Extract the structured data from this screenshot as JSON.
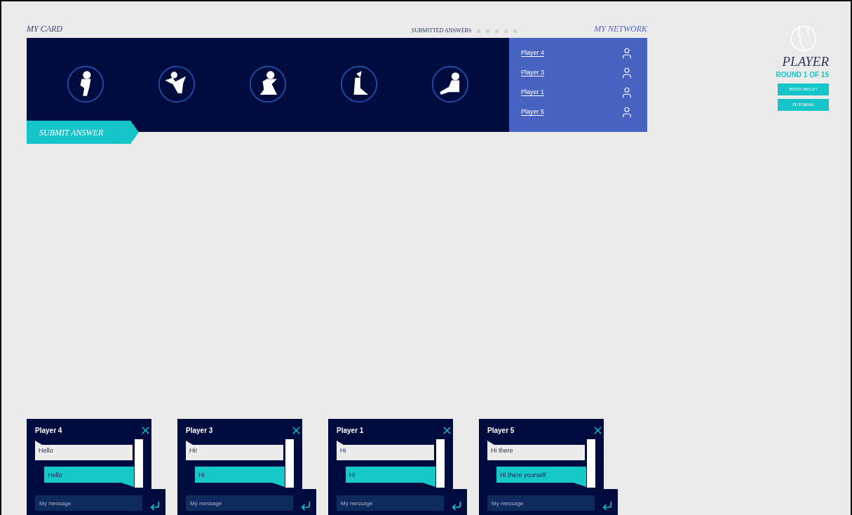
{
  "card": {
    "title": "MY CARD",
    "figures": [
      {
        "kind": "leaping"
      },
      {
        "kind": "flying"
      },
      {
        "kind": "kneeling"
      },
      {
        "kind": "seated"
      },
      {
        "kind": "reclining"
      }
    ],
    "submit_button": "SUBMIT ANSWER"
  },
  "submitted_answers": {
    "label": "SUBMITTED ANSWERS",
    "dots": [
      {
        "filled": false
      },
      {
        "filled": false
      },
      {
        "filled": false
      },
      {
        "filled": false
      },
      {
        "filled": false
      }
    ]
  },
  "network": {
    "title": "MY NETWORK",
    "players": [
      "Player 4",
      "Player 3",
      "Player 1",
      "Player 5"
    ]
  },
  "player": {
    "name": "PLAYER",
    "round": "ROUND 1 OF 15",
    "buttons": [
      "NEED HELP?",
      "TUTORIAL"
    ]
  },
  "chats": [
    {
      "title": "Player 4",
      "messages": [
        {
          "kind": "incoming",
          "text": "Hello"
        },
        {
          "kind": "outgoing",
          "text": "Hello"
        }
      ],
      "placeholder": "My message"
    },
    {
      "title": "Player 3",
      "messages": [
        {
          "kind": "incoming",
          "text": "Hi!"
        },
        {
          "kind": "outgoing",
          "text": "Hi"
        }
      ],
      "placeholder": "My message"
    },
    {
      "title": "Player 1",
      "messages": [
        {
          "kind": "incoming",
          "text": "Hi"
        },
        {
          "kind": "outgoing",
          "text": "Hi"
        }
      ],
      "placeholder": "My message"
    },
    {
      "title": "Player 5",
      "messages": [
        {
          "kind": "incoming",
          "text": "Hi there"
        },
        {
          "kind": "outgoing",
          "text": "Hi there yourself"
        }
      ],
      "placeholder": "My message"
    }
  ]
}
